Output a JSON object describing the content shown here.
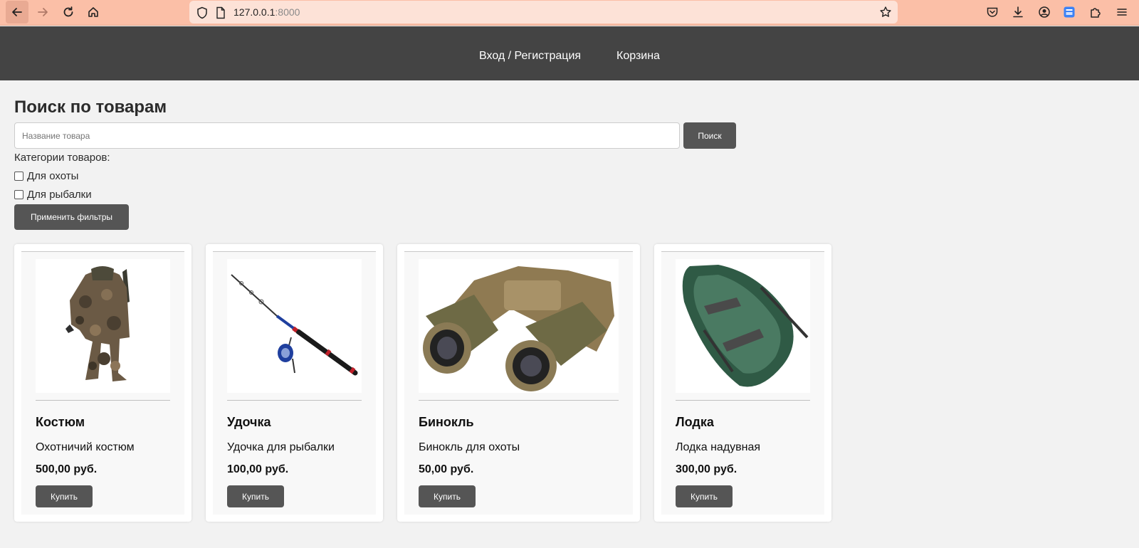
{
  "browser": {
    "url_host": "127.0.0.1",
    "url_port": ":8000"
  },
  "header": {
    "login_label": "Вход / Регистрация",
    "cart_label": "Корзина"
  },
  "search": {
    "title": "Поиск по товарам",
    "placeholder": "Название товара",
    "button_label": "Поиск",
    "categories_label": "Категории товаров:",
    "categories": [
      {
        "label": "Для охоты",
        "checked": false
      },
      {
        "label": "Для рыбалки",
        "checked": false
      }
    ],
    "apply_label": "Применить фильтры"
  },
  "products": [
    {
      "name": "Костюм",
      "description": "Охотничий костюм",
      "price": "500,00 руб.",
      "buy_label": "Купить",
      "image_icon": "hunting-suit-image"
    },
    {
      "name": "Удочка",
      "description": "Удочка для рыбалки",
      "price": "100,00 руб.",
      "buy_label": "Купить",
      "image_icon": "fishing-rod-image"
    },
    {
      "name": "Бинокль",
      "description": "Бинокль для охоты",
      "price": "50,00 руб.",
      "buy_label": "Купить",
      "image_icon": "binoculars-image"
    },
    {
      "name": "Лодка",
      "description": "Лодка надувная",
      "price": "300,00 руб.",
      "buy_label": "Купить",
      "image_icon": "inflatable-boat-image"
    }
  ],
  "colors": {
    "header_bg": "#444444",
    "button_bg": "#555555",
    "browser_bar": "#fbbfa7"
  }
}
